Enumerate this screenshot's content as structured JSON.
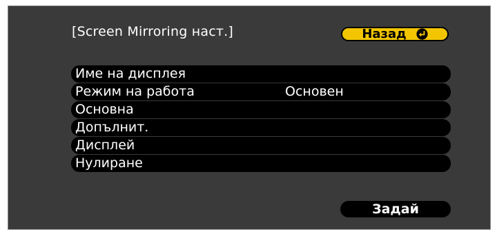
{
  "title": "[Screen Mirroring наст.]",
  "back_button": {
    "label": "Назад"
  },
  "menu": {
    "items": [
      {
        "label": "Име на дисплея",
        "value": ""
      },
      {
        "label": "Режим на работа",
        "value": "Основен"
      },
      {
        "label": "Основна",
        "value": ""
      },
      {
        "label": "Допълнит.",
        "value": ""
      },
      {
        "label": "Дисплей",
        "value": ""
      },
      {
        "label": "Нулиране",
        "value": ""
      }
    ]
  },
  "set_button": {
    "label": "Задай"
  },
  "colors": {
    "screen_bg": "#3a3a3a",
    "item_bg": "#000000",
    "accent": "#f2c500",
    "text": "#ffffff"
  },
  "icons": {
    "back": "enter-icon"
  }
}
